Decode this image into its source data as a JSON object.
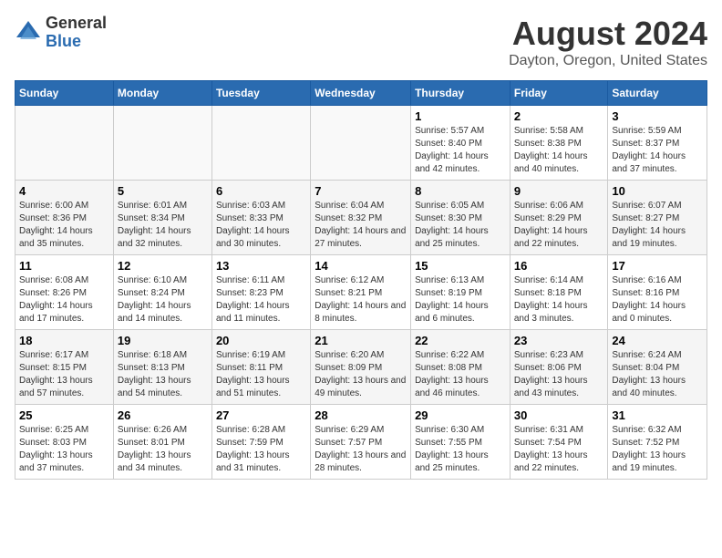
{
  "logo": {
    "general": "General",
    "blue": "Blue"
  },
  "title": "August 2024",
  "location": "Dayton, Oregon, United States",
  "days_header": [
    "Sunday",
    "Monday",
    "Tuesday",
    "Wednesday",
    "Thursday",
    "Friday",
    "Saturday"
  ],
  "weeks": [
    [
      {
        "day": "",
        "info": ""
      },
      {
        "day": "",
        "info": ""
      },
      {
        "day": "",
        "info": ""
      },
      {
        "day": "",
        "info": ""
      },
      {
        "day": "1",
        "info": "Sunrise: 5:57 AM\nSunset: 8:40 PM\nDaylight: 14 hours and 42 minutes."
      },
      {
        "day": "2",
        "info": "Sunrise: 5:58 AM\nSunset: 8:38 PM\nDaylight: 14 hours and 40 minutes."
      },
      {
        "day": "3",
        "info": "Sunrise: 5:59 AM\nSunset: 8:37 PM\nDaylight: 14 hours and 37 minutes."
      }
    ],
    [
      {
        "day": "4",
        "info": "Sunrise: 6:00 AM\nSunset: 8:36 PM\nDaylight: 14 hours and 35 minutes."
      },
      {
        "day": "5",
        "info": "Sunrise: 6:01 AM\nSunset: 8:34 PM\nDaylight: 14 hours and 32 minutes."
      },
      {
        "day": "6",
        "info": "Sunrise: 6:03 AM\nSunset: 8:33 PM\nDaylight: 14 hours and 30 minutes."
      },
      {
        "day": "7",
        "info": "Sunrise: 6:04 AM\nSunset: 8:32 PM\nDaylight: 14 hours and 27 minutes."
      },
      {
        "day": "8",
        "info": "Sunrise: 6:05 AM\nSunset: 8:30 PM\nDaylight: 14 hours and 25 minutes."
      },
      {
        "day": "9",
        "info": "Sunrise: 6:06 AM\nSunset: 8:29 PM\nDaylight: 14 hours and 22 minutes."
      },
      {
        "day": "10",
        "info": "Sunrise: 6:07 AM\nSunset: 8:27 PM\nDaylight: 14 hours and 19 minutes."
      }
    ],
    [
      {
        "day": "11",
        "info": "Sunrise: 6:08 AM\nSunset: 8:26 PM\nDaylight: 14 hours and 17 minutes."
      },
      {
        "day": "12",
        "info": "Sunrise: 6:10 AM\nSunset: 8:24 PM\nDaylight: 14 hours and 14 minutes."
      },
      {
        "day": "13",
        "info": "Sunrise: 6:11 AM\nSunset: 8:23 PM\nDaylight: 14 hours and 11 minutes."
      },
      {
        "day": "14",
        "info": "Sunrise: 6:12 AM\nSunset: 8:21 PM\nDaylight: 14 hours and 8 minutes."
      },
      {
        "day": "15",
        "info": "Sunrise: 6:13 AM\nSunset: 8:19 PM\nDaylight: 14 hours and 6 minutes."
      },
      {
        "day": "16",
        "info": "Sunrise: 6:14 AM\nSunset: 8:18 PM\nDaylight: 14 hours and 3 minutes."
      },
      {
        "day": "17",
        "info": "Sunrise: 6:16 AM\nSunset: 8:16 PM\nDaylight: 14 hours and 0 minutes."
      }
    ],
    [
      {
        "day": "18",
        "info": "Sunrise: 6:17 AM\nSunset: 8:15 PM\nDaylight: 13 hours and 57 minutes."
      },
      {
        "day": "19",
        "info": "Sunrise: 6:18 AM\nSunset: 8:13 PM\nDaylight: 13 hours and 54 minutes."
      },
      {
        "day": "20",
        "info": "Sunrise: 6:19 AM\nSunset: 8:11 PM\nDaylight: 13 hours and 51 minutes."
      },
      {
        "day": "21",
        "info": "Sunrise: 6:20 AM\nSunset: 8:09 PM\nDaylight: 13 hours and 49 minutes."
      },
      {
        "day": "22",
        "info": "Sunrise: 6:22 AM\nSunset: 8:08 PM\nDaylight: 13 hours and 46 minutes."
      },
      {
        "day": "23",
        "info": "Sunrise: 6:23 AM\nSunset: 8:06 PM\nDaylight: 13 hours and 43 minutes."
      },
      {
        "day": "24",
        "info": "Sunrise: 6:24 AM\nSunset: 8:04 PM\nDaylight: 13 hours and 40 minutes."
      }
    ],
    [
      {
        "day": "25",
        "info": "Sunrise: 6:25 AM\nSunset: 8:03 PM\nDaylight: 13 hours and 37 minutes."
      },
      {
        "day": "26",
        "info": "Sunrise: 6:26 AM\nSunset: 8:01 PM\nDaylight: 13 hours and 34 minutes."
      },
      {
        "day": "27",
        "info": "Sunrise: 6:28 AM\nSunset: 7:59 PM\nDaylight: 13 hours and 31 minutes."
      },
      {
        "day": "28",
        "info": "Sunrise: 6:29 AM\nSunset: 7:57 PM\nDaylight: 13 hours and 28 minutes."
      },
      {
        "day": "29",
        "info": "Sunrise: 6:30 AM\nSunset: 7:55 PM\nDaylight: 13 hours and 25 minutes."
      },
      {
        "day": "30",
        "info": "Sunrise: 6:31 AM\nSunset: 7:54 PM\nDaylight: 13 hours and 22 minutes."
      },
      {
        "day": "31",
        "info": "Sunrise: 6:32 AM\nSunset: 7:52 PM\nDaylight: 13 hours and 19 minutes."
      }
    ]
  ]
}
